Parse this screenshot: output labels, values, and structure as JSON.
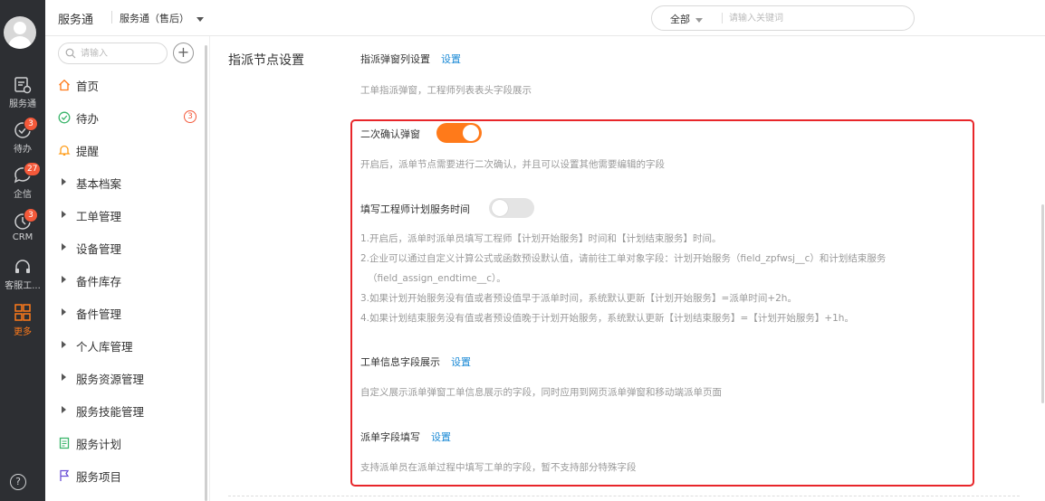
{
  "rail": {
    "items": [
      {
        "label": "服务通",
        "icon": "service-icon",
        "badge": ""
      },
      {
        "label": "待办",
        "icon": "todo-icon",
        "badge": "3"
      },
      {
        "label": "企信",
        "icon": "chat-icon",
        "badge": "27"
      },
      {
        "label": "CRM",
        "icon": "crm-icon",
        "badge": "3"
      },
      {
        "label": "客服工...",
        "icon": "headset-icon",
        "badge": ""
      },
      {
        "label": "更多",
        "icon": "grid-icon",
        "badge": ""
      }
    ],
    "help": "?",
    "accent": "#ff7a1a"
  },
  "topbar": {
    "title": "服务通",
    "app_switch": "服务通（售后）",
    "search_scope": "全部",
    "search_placeholder": "请输入关键词"
  },
  "sidemenu": {
    "search_placeholder": "请输入",
    "add": "+",
    "items": [
      {
        "label": "首页",
        "icon": "home-icon",
        "count": ""
      },
      {
        "label": "待办",
        "icon": "check-circle-icon",
        "count": "3"
      },
      {
        "label": "提醒",
        "icon": "bell-icon",
        "count": ""
      },
      {
        "label": "基本档案",
        "icon": "expand-triangle-icon",
        "count": ""
      },
      {
        "label": "工单管理",
        "icon": "expand-triangle-icon",
        "count": ""
      },
      {
        "label": "设备管理",
        "icon": "expand-triangle-icon",
        "count": ""
      },
      {
        "label": "备件库存",
        "icon": "expand-triangle-icon",
        "count": ""
      },
      {
        "label": "备件管理",
        "icon": "expand-triangle-icon",
        "count": ""
      },
      {
        "label": "个人库管理",
        "icon": "expand-triangle-icon",
        "count": ""
      },
      {
        "label": "服务资源管理",
        "icon": "expand-triangle-icon",
        "count": ""
      },
      {
        "label": "服务技能管理",
        "icon": "expand-triangle-icon",
        "count": ""
      },
      {
        "label": "服务计划",
        "icon": "document-icon",
        "count": ""
      },
      {
        "label": "服务项目",
        "icon": "flag-icon",
        "count": ""
      }
    ]
  },
  "main": {
    "section_title": "指派节点设置",
    "assign_popup_columns": {
      "title": "指派弹窗列设置",
      "link": "设置",
      "desc": "工单指派弹窗，工程师列表表头字段展示"
    },
    "second_confirm": {
      "title": "二次确认弹窗",
      "enabled": true,
      "desc": "开启后，派单节点需要进行二次确认，并且可以设置其他需要编辑的字段"
    },
    "plan_time": {
      "title": "填写工程师计划服务时间",
      "enabled": false,
      "notes": [
        "1.开启后，派单时派单员填写工程师【计划开始服务】时间和【计划结束服务】时间。",
        "2.企业可以通过自定义计算公式或函数预设默认值，请前往工单对象字段：计划开始服务（field_zpfwsj__c）和计划结束服务",
        "（field_assign_endtime__c）。",
        "3.如果计划开始服务没有值或者预设值早于派单时间，系统默认更新【计划开始服务】=派单时间+2h。",
        "4.如果计划结束服务没有值或者预设值晚于计划开始服务，系统默认更新【计划结束服务】=【计划开始服务】+1h。"
      ]
    },
    "order_info_fields": {
      "title": "工单信息字段展示",
      "link": "设置",
      "desc": "自定义展示派单弹窗工单信息展示的字段，同时应用到网页派单弹窗和移动端派单页面"
    },
    "dispatch_fields": {
      "title": "派单字段填写",
      "link": "设置",
      "desc": "支持派单员在派单过程中填写工单的字段，暂不支持部分特殊字段"
    }
  }
}
